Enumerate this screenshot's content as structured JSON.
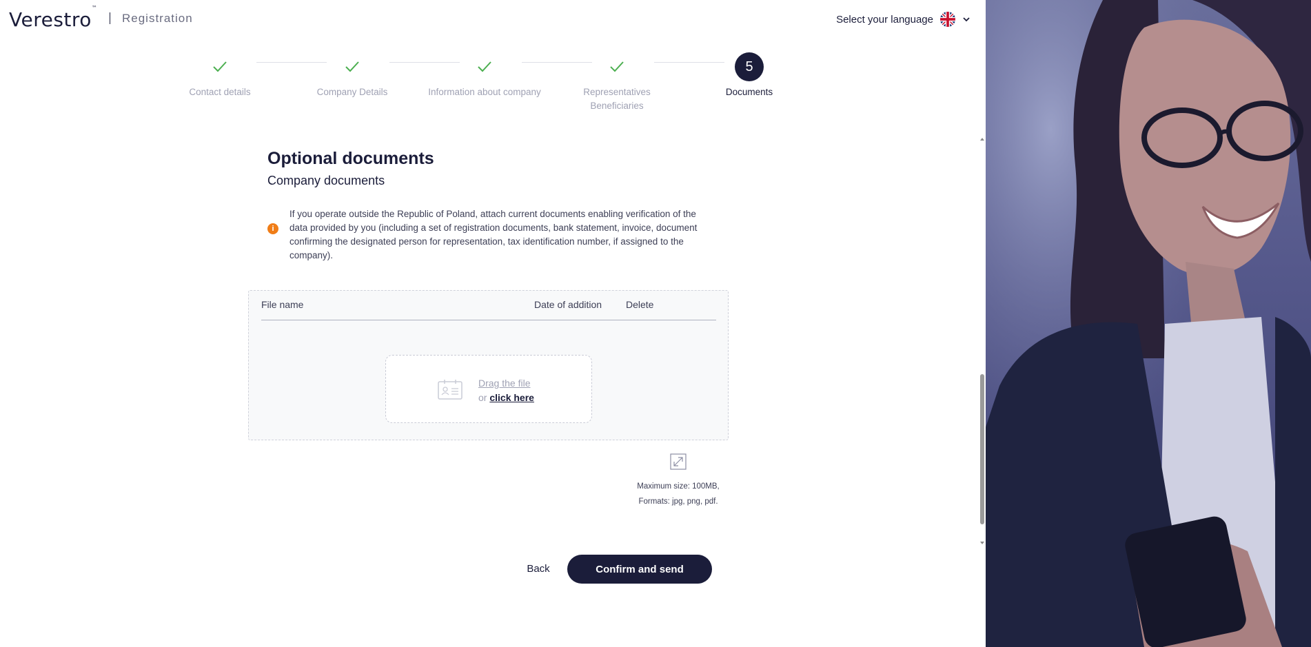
{
  "header": {
    "logo": "Verestro",
    "logo_tm": "™",
    "app_title": "Registration",
    "language_label": "Select your language"
  },
  "stepper": {
    "steps": [
      {
        "label": "Contact details",
        "state": "done"
      },
      {
        "label": "Company Details",
        "state": "done"
      },
      {
        "label": "Information about company",
        "state": "done"
      },
      {
        "label": "Representatives Beneficiaries",
        "state": "done"
      },
      {
        "label": "Documents",
        "state": "active",
        "number": "5"
      }
    ]
  },
  "section": {
    "title": "Optional documents",
    "subtitle": "Company documents",
    "info_icon": "i",
    "info_text": "If you operate outside the Republic of Poland, attach current documents enabling verification of the data provided by you (including a set of registration documents, bank statement, invoice, document confirming the designated person for representation, tax identification number, if assigned to the company)."
  },
  "files_table": {
    "columns": {
      "file_name": "File name",
      "date": "Date of addition",
      "delete": "Delete"
    },
    "rows": []
  },
  "dropzone": {
    "drag_text": "Drag the file",
    "or_text": "or",
    "click_text": "click here"
  },
  "limits": {
    "max_size": "Maximum size: 100MB,",
    "formats": "Formats: jpg, png, pdf."
  },
  "actions": {
    "back": "Back",
    "confirm": "Confirm and send"
  },
  "colors": {
    "primary": "#1b1d3a",
    "success": "#4caf50",
    "warning": "#f07d17",
    "muted": "#9fa1b3"
  }
}
